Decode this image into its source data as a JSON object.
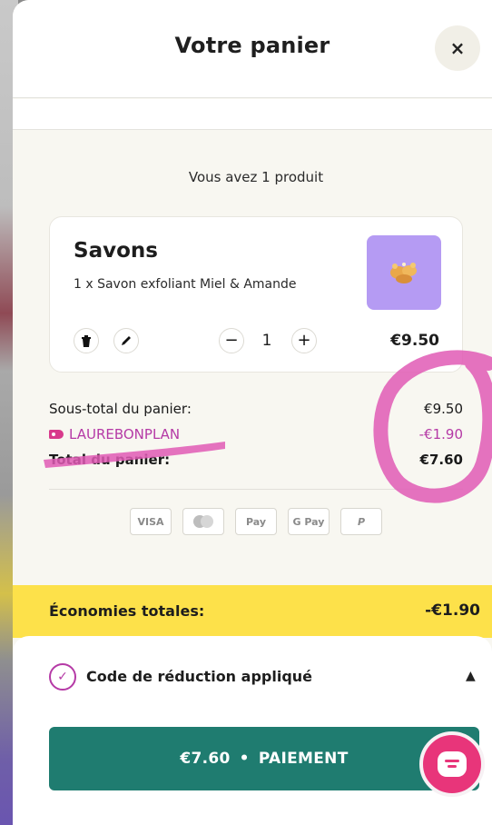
{
  "header": {
    "title": "Votre panier",
    "close_label": "×"
  },
  "cart": {
    "count_text": "Vous avez 1 produit",
    "item": {
      "category": "Savons",
      "description": "1 x Savon exfoliant Miel & Amande",
      "quantity": "1",
      "price": "€9.50",
      "thumbnail_color": "#b59bf3"
    }
  },
  "summary": {
    "subtotal_label": "Sous-total du panier:",
    "subtotal_value": "€9.50",
    "discount_label": "LAUREBONPLAN",
    "discount_value": "-€1.90",
    "total_label": "Total du panier:",
    "total_value": "€7.60"
  },
  "payments": [
    {
      "name": "visa",
      "label": "VISA"
    },
    {
      "name": "mastercard",
      "label": ""
    },
    {
      "name": "apple-pay",
      "label": " Pay"
    },
    {
      "name": "google-pay",
      "label": "G Pay"
    },
    {
      "name": "paypal",
      "label": "P"
    }
  ],
  "savings": {
    "label": "Économies totales:",
    "value": "-€1.90"
  },
  "promo": {
    "label": "Code de réduction appliqué"
  },
  "checkout": {
    "amount": "€7.60",
    "separator": "•",
    "label": "PAIEMENT"
  },
  "colors": {
    "accent_magenta": "#b53aa6",
    "checkout_green": "#1f7c70",
    "savings_yellow": "#fde14a",
    "chat_pink": "#e8357a",
    "annotation_pink": "#e05bb5"
  }
}
